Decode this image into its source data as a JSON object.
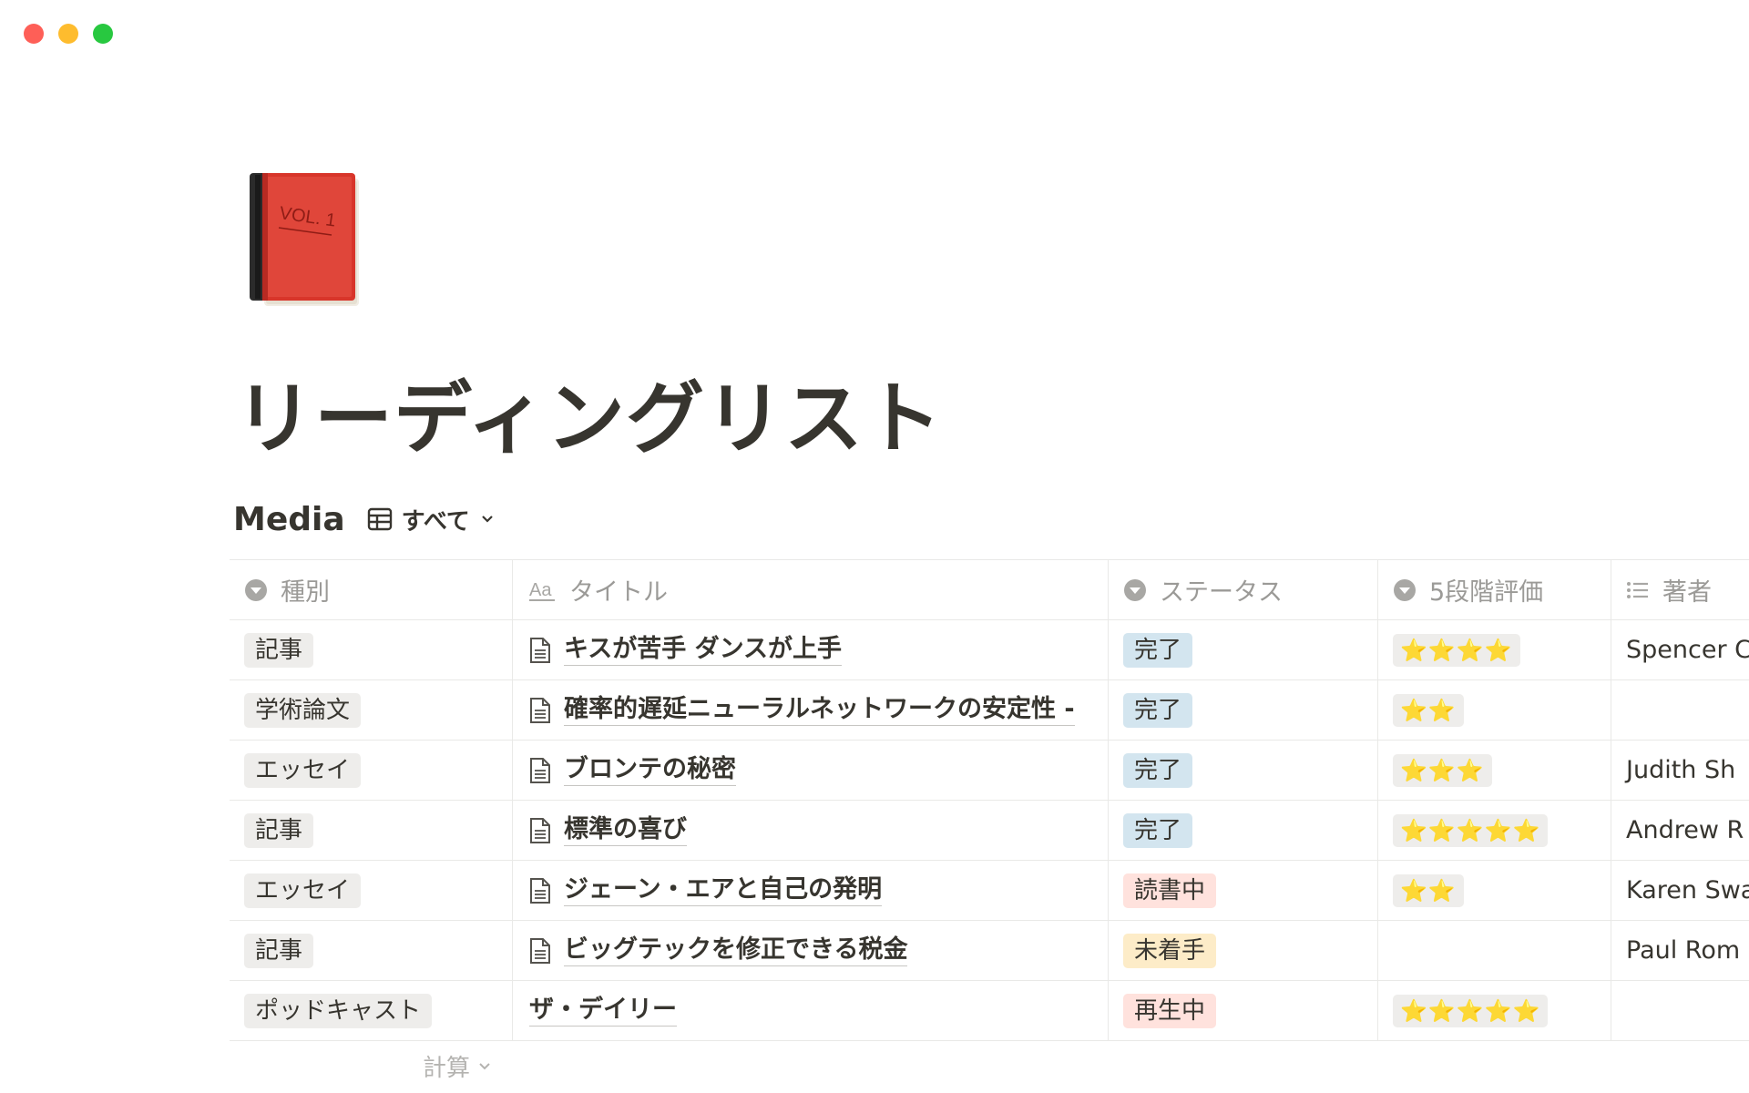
{
  "page": {
    "title": "リーディングリスト",
    "icon": "red-book-icon",
    "book_cover_text": "VOL. 1"
  },
  "database": {
    "name": "Media",
    "view": {
      "label": "すべて",
      "icon": "table-icon"
    },
    "columns": [
      {
        "label": "種別",
        "icon": "select-icon"
      },
      {
        "label": "タイトル",
        "icon": "text-aa-icon"
      },
      {
        "label": "ステータス",
        "icon": "select-icon"
      },
      {
        "label": "5段階評価",
        "icon": "select-icon"
      },
      {
        "label": "著者",
        "icon": "list-icon"
      }
    ],
    "rows": [
      {
        "type": "記事",
        "title": "キスが苦手 ダンスが上手",
        "status": "完了",
        "status_color": "blue",
        "rating": "⭐⭐⭐⭐",
        "author": "Spencer C"
      },
      {
        "type": "学術論文",
        "title": "確率的遅延ニューラルネットワークの安定性 -",
        "status": "完了",
        "status_color": "blue",
        "rating": "⭐⭐",
        "author": ""
      },
      {
        "type": "エッセイ",
        "title": "ブロンテの秘密",
        "status": "完了",
        "status_color": "blue",
        "rating": "⭐⭐⭐",
        "author": "Judith Sh"
      },
      {
        "type": "記事",
        "title": "標準の喜び",
        "status": "完了",
        "status_color": "blue",
        "rating": "⭐⭐⭐⭐⭐",
        "author": "Andrew R"
      },
      {
        "type": "エッセイ",
        "title": "ジェーン・エアと自己の発明",
        "status": "読書中",
        "status_color": "red",
        "rating": "⭐⭐",
        "author": "Karen Swa"
      },
      {
        "type": "記事",
        "title": "ビッグテックを修正できる税金",
        "status": "未着手",
        "status_color": "yellow",
        "rating": "",
        "author": "Paul Rom"
      },
      {
        "type": "ポッドキャスト",
        "title": "ザ・デイリー",
        "status": "再生中",
        "status_color": "red",
        "rating": "⭐⭐⭐⭐⭐",
        "author": ""
      }
    ],
    "calculate_label": "計算"
  },
  "colors": {
    "text": "#37352f",
    "muted": "#9b9a97",
    "tag_gray": "#eeedeb",
    "tag_blue": "#d3e5ef",
    "tag_red": "#ffe2dd",
    "tag_yellow": "#fdecc8"
  }
}
